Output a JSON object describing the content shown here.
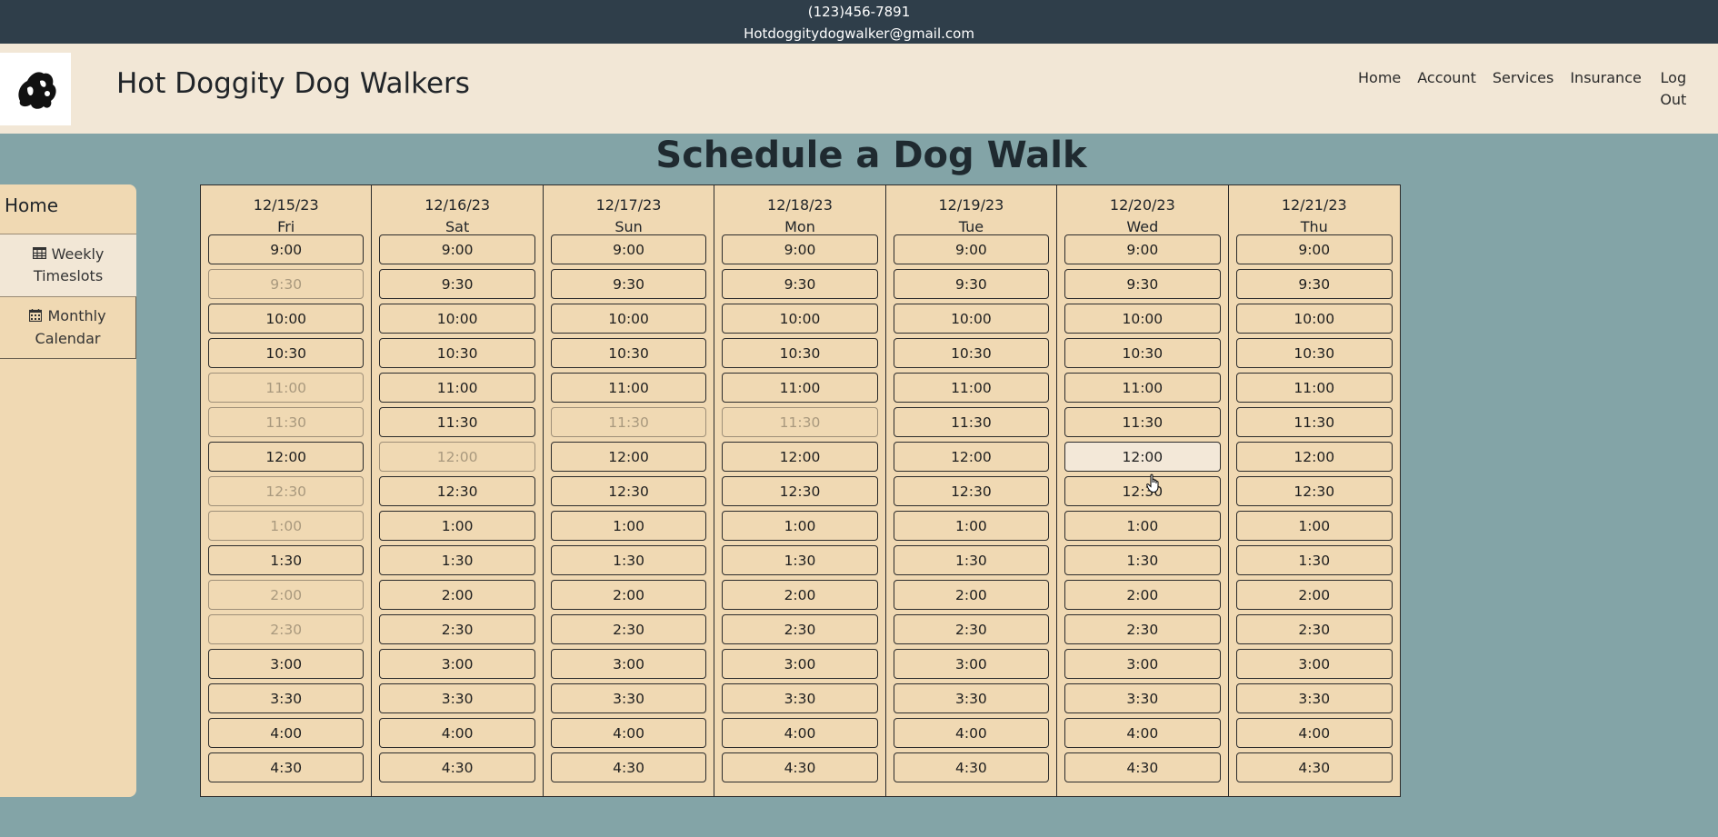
{
  "contact": {
    "phone": "(123)456-7891",
    "email": "Hotdoggitydogwalker@gmail.com"
  },
  "header": {
    "title": "Hot Doggity Dog Walkers",
    "nav": {
      "home": "Home",
      "account": "Account",
      "services": "Services",
      "insurance": "Insurance",
      "logout": "Log Out"
    }
  },
  "page": {
    "title": "Schedule a Dog Walk"
  },
  "sidebar": {
    "home": "Home",
    "items": [
      {
        "label": "Weekly Timeslots",
        "icon": "table-icon",
        "active": true
      },
      {
        "label": "Monthly Calendar",
        "icon": "calendar-icon",
        "active": false
      }
    ]
  },
  "schedule": {
    "times": [
      "9:00",
      "9:30",
      "10:00",
      "10:30",
      "11:00",
      "11:30",
      "12:00",
      "12:30",
      "1:00",
      "1:30",
      "2:00",
      "2:30",
      "3:00",
      "3:30",
      "4:00",
      "4:30"
    ],
    "days": [
      {
        "date": "12/15/23",
        "weekday": "Fri",
        "unavailable": [
          "9:30",
          "11:00",
          "11:30",
          "12:30",
          "1:00",
          "2:00",
          "2:30"
        ]
      },
      {
        "date": "12/16/23",
        "weekday": "Sat",
        "unavailable": [
          "12:00"
        ]
      },
      {
        "date": "12/17/23",
        "weekday": "Sun",
        "unavailable": [
          "11:30"
        ]
      },
      {
        "date": "12/18/23",
        "weekday": "Mon",
        "unavailable": [
          "11:30"
        ]
      },
      {
        "date": "12/19/23",
        "weekday": "Tue",
        "unavailable": []
      },
      {
        "date": "12/20/23",
        "weekday": "Wed",
        "unavailable": [],
        "hovered": "12:00"
      },
      {
        "date": "12/21/23",
        "weekday": "Thu",
        "unavailable": []
      }
    ]
  },
  "colors": {
    "top_bar": "#2f3e4a",
    "header": "#f2e7d6",
    "background": "#83a4a7",
    "panel": "#f0d9b3",
    "unavailable_text": "#a9997e"
  }
}
